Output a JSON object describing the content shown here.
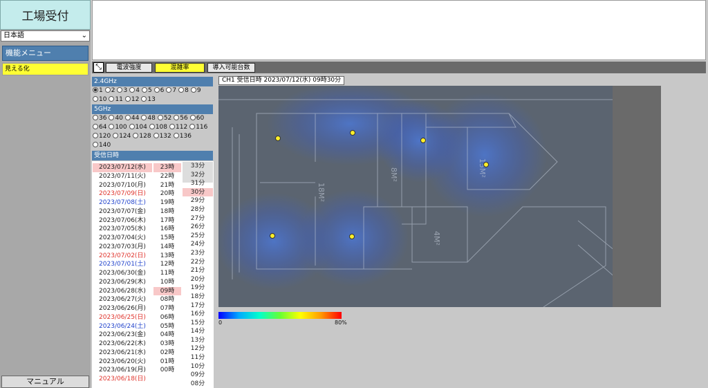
{
  "app": {
    "title": "工場受付"
  },
  "language": {
    "selected": "日本語"
  },
  "menu": {
    "header": "機能メニュー",
    "items": [
      "見える化"
    ]
  },
  "manual_button": "マニュアル",
  "toolbar": {
    "tabs": [
      "電波強度",
      "混雑率",
      "導入可能台数"
    ],
    "active_tab": "混雑率"
  },
  "band_24": {
    "label": "2.4GHz",
    "selected": "1",
    "channels": [
      "1",
      "2",
      "3",
      "4",
      "5",
      "6",
      "7",
      "8",
      "9",
      "10",
      "11",
      "12",
      "13"
    ]
  },
  "band_5": {
    "label": "5GHz",
    "channels": [
      "36",
      "40",
      "44",
      "48",
      "52",
      "56",
      "60",
      "64",
      "100",
      "104",
      "108",
      "112",
      "116",
      "120",
      "124",
      "128",
      "132",
      "136",
      "140"
    ]
  },
  "received": {
    "label": "受信日時",
    "dates": [
      {
        "t": "2023/07/12(水)",
        "k": "sel"
      },
      {
        "t": "2023/07/11(火)",
        "k": ""
      },
      {
        "t": "2023/07/10(月)",
        "k": ""
      },
      {
        "t": "2023/07/09(日)",
        "k": "sun"
      },
      {
        "t": "2023/07/08(土)",
        "k": "sat"
      },
      {
        "t": "2023/07/07(金)",
        "k": ""
      },
      {
        "t": "2023/07/06(木)",
        "k": ""
      },
      {
        "t": "2023/07/05(水)",
        "k": ""
      },
      {
        "t": "2023/07/04(火)",
        "k": ""
      },
      {
        "t": "2023/07/03(月)",
        "k": ""
      },
      {
        "t": "2023/07/02(日)",
        "k": "sun"
      },
      {
        "t": "2023/07/01(土)",
        "k": "sat"
      },
      {
        "t": "2023/06/30(金)",
        "k": ""
      },
      {
        "t": "2023/06/29(木)",
        "k": ""
      },
      {
        "t": "2023/06/28(水)",
        "k": ""
      },
      {
        "t": "2023/06/27(火)",
        "k": ""
      },
      {
        "t": "2023/06/26(月)",
        "k": ""
      },
      {
        "t": "2023/06/25(日)",
        "k": "sun"
      },
      {
        "t": "2023/06/24(土)",
        "k": "sat"
      },
      {
        "t": "2023/06/23(金)",
        "k": ""
      },
      {
        "t": "2023/06/22(木)",
        "k": ""
      },
      {
        "t": "2023/06/21(水)",
        "k": ""
      },
      {
        "t": "2023/06/20(火)",
        "k": ""
      },
      {
        "t": "2023/06/19(月)",
        "k": ""
      },
      {
        "t": "2023/06/18(日)",
        "k": "sun"
      }
    ],
    "hours": [
      "23時",
      "22時",
      "21時",
      "20時",
      "19時",
      "18時",
      "17時",
      "16時",
      "15時",
      "14時",
      "13時",
      "12時",
      "11時",
      "10時",
      "09時",
      "08時",
      "07時",
      "06時",
      "05時",
      "04時",
      "03時",
      "02時",
      "01時",
      "00時"
    ],
    "hours_selected": [
      "23時",
      "09時"
    ],
    "minutes": [
      "33分",
      "32分",
      "31分",
      "30分",
      "29分",
      "28分",
      "27分",
      "26分",
      "25分",
      "24分",
      "23分",
      "22分",
      "21分",
      "20分",
      "19分",
      "18分",
      "17分",
      "16分",
      "15分",
      "14分",
      "13分",
      "12分",
      "11分",
      "10分",
      "09分",
      "08分"
    ],
    "minutes_selected": "30分"
  },
  "map": {
    "label": "CH1 受信日時 2023/07/12(水) 09時30分",
    "room_labels": [
      "18M²",
      "8M²",
      "15M²",
      "4M²"
    ]
  },
  "legend": {
    "min": "0",
    "max": "80%"
  }
}
